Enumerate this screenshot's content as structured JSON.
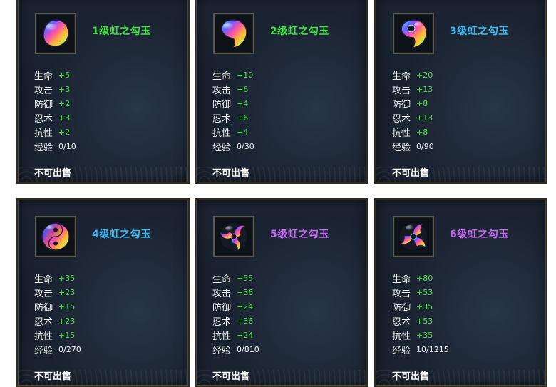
{
  "stat_labels": {
    "hp": "生命",
    "attack": "攻击",
    "defense": "防御",
    "ninjutsu": "忍术",
    "resistance": "抗性",
    "exp": "经验"
  },
  "unsellable_text": "不可出售",
  "items": [
    {
      "title": "1级虹之勾玉",
      "title_color": "#3de23a",
      "hp": "+5",
      "attack": "+3",
      "defense": "+2",
      "ninjutsu": "+3",
      "resistance": "+2",
      "exp": "0/10",
      "icon": "magatama-level-1-icon"
    },
    {
      "title": "2级虹之勾玉",
      "title_color": "#3de23a",
      "hp": "+10",
      "attack": "+6",
      "defense": "+4",
      "ninjutsu": "+6",
      "resistance": "+4",
      "exp": "0/30",
      "icon": "magatama-level-2-icon"
    },
    {
      "title": "3级虹之勾玉",
      "title_color": "#3eb8f0",
      "hp": "+20",
      "attack": "+13",
      "defense": "+8",
      "ninjutsu": "+13",
      "resistance": "+8",
      "exp": "0/90",
      "icon": "magatama-level-3-icon"
    },
    {
      "title": "4级虹之勾玉",
      "title_color": "#3eb8f0",
      "hp": "+35",
      "attack": "+23",
      "defense": "+15",
      "ninjutsu": "+23",
      "resistance": "+15",
      "exp": "0/270",
      "icon": "magatama-level-4-icon"
    },
    {
      "title": "5级虹之勾玉",
      "title_color": "#c468f2",
      "hp": "+55",
      "attack": "+36",
      "defense": "+24",
      "ninjutsu": "+36",
      "resistance": "+24",
      "exp": "0/810",
      "icon": "magatama-level-5-icon"
    },
    {
      "title": "6级虹之勾玉",
      "title_color": "#c468f2",
      "hp": "+80",
      "attack": "+53",
      "defense": "+35",
      "ninjutsu": "+53",
      "resistance": "+35",
      "exp": "10/1215",
      "icon": "magatama-level-6-icon"
    }
  ]
}
